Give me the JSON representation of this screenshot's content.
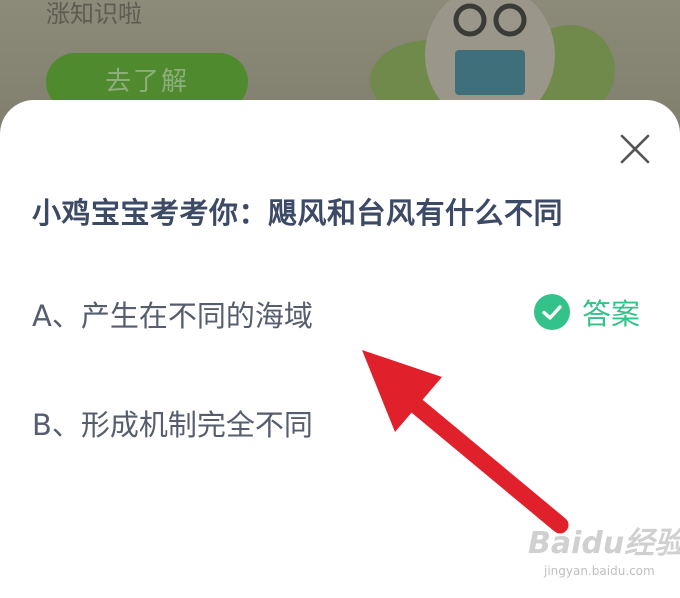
{
  "banner": {
    "text": "涨知识啦",
    "button_label": "去了解"
  },
  "dialog": {
    "question": "小鸡宝宝考考你：飓风和台风有什么不同",
    "options": [
      {
        "label": "A、产生在不同的海域",
        "is_answer": true
      },
      {
        "label": "B、形成机制完全不同",
        "is_answer": false
      }
    ],
    "answer_label": "答案",
    "close_icon": "close-icon",
    "check_icon": "check-circle-icon"
  },
  "annotation": {
    "arrow_color": "#e0202a"
  },
  "watermark": {
    "logo": "Baidu经验",
    "url": "jingyan.baidu.com"
  },
  "colors": {
    "question_text": "#3d4a66",
    "option_text": "#555d6e",
    "accent_green": "#32c28a",
    "banner_button": "#4f8a2e"
  }
}
